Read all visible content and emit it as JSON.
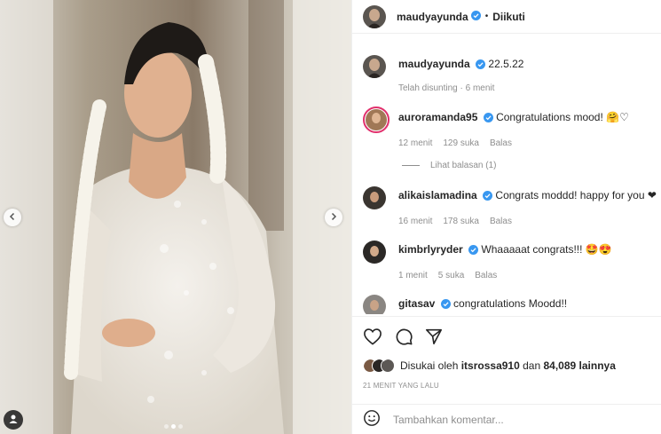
{
  "post": {
    "author": "maudyayunda",
    "follow_status": "Diikuti",
    "caption": "22.5.22",
    "caption_meta": "Telah disunting · 6 menit"
  },
  "comments": [
    {
      "user": "auroramanda95",
      "text": "Congratulations mood! 🤗♡",
      "time": "12 menit",
      "likes": "129 suka",
      "reply": "Balas"
    },
    {
      "user": "alikaislamadina",
      "text": "Congrats moddd! happy for you ❤",
      "time": "16 menit",
      "likes": "178 suka",
      "reply": "Balas"
    },
    {
      "user": "kimbrlyryder",
      "text": "Whaaaaat congrats!!! 🤩😍",
      "time": "1 menit",
      "likes": "5 suka",
      "reply": "Balas"
    },
    {
      "user": "gitasav",
      "text": "congratulations Moodd!!"
    }
  ],
  "view_replies": "Lihat balasan (1)",
  "likes": {
    "prefix": "Disukai oleh",
    "user": "itsrossa910",
    "conj": "dan",
    "count": "84,089 lainnya"
  },
  "timestamp": "21 MENIT YANG LALU",
  "comment_placeholder": "Tambahkan komentar...",
  "media": {
    "carousel_total": 3,
    "carousel_active": 2
  },
  "colors": {
    "verified": "#3897f0",
    "heart_red": "#ed4956",
    "text_gray": "#8e8e8e"
  },
  "icons": [
    "heart-icon",
    "comment-icon",
    "share-icon",
    "smiley-icon",
    "user-tag-icon",
    "chevron-left-icon",
    "chevron-right-icon",
    "verified-icon"
  ]
}
